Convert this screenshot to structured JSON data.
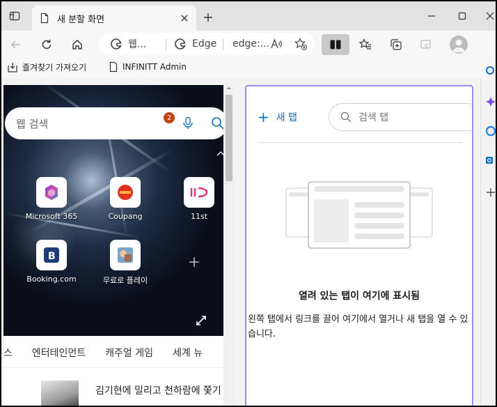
{
  "tab": {
    "title": "새 분할 화면"
  },
  "address": {
    "seg1_label": "웹...",
    "seg2_label": "Edge",
    "seg3_label": "edge:...",
    "read_aloud": "Ă"
  },
  "bookmarks": [
    {
      "label": "즐겨찾기 가져오기"
    },
    {
      "label": "INFINITT Admin"
    }
  ],
  "left_pane": {
    "search_placeholder": "웹 검색",
    "notification_count": "2",
    "tiles": [
      {
        "name": "Microsoft 365"
      },
      {
        "name": "Coupang"
      },
      {
        "name": "11st"
      },
      {
        "name": "Booking.com"
      },
      {
        "name": "무료로 플레이"
      }
    ],
    "categories": [
      "스",
      "엔터테인먼트",
      "캐주얼 게임",
      "세계 뉴"
    ],
    "news_headline": "김기현에 밀리고 천하람에 쫓기"
  },
  "right_pane": {
    "new_tab_label": "새 탭",
    "search_placeholder": "검색 탭",
    "heading": "열려 있는 탭이 여기에 표시됨",
    "body": "왼쪽 탭에서 링크를 끌어 여기에서 열거나 새 탭을 열 수 있습니다."
  },
  "colors": {
    "accent": "#0f6cbd",
    "pane_border": "#9b8ef0",
    "badge": "#c2410c"
  }
}
